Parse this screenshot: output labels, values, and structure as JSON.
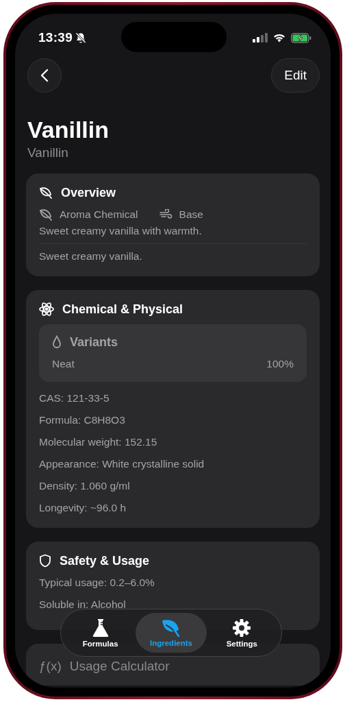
{
  "status_bar": {
    "time": "13:39",
    "silent": true,
    "charging": true
  },
  "nav": {
    "edit_label": "Edit"
  },
  "title": "Vanillin",
  "subtitle": "Vanillin",
  "overview": {
    "title": "Overview",
    "category": "Aroma Chemical",
    "note": "Base",
    "description": "Sweet creamy vanilla with warmth.",
    "summary": "Sweet creamy vanilla."
  },
  "chemical": {
    "title": "Chemical & Physical",
    "variants": {
      "title": "Variants",
      "rows": [
        {
          "name": "Neat",
          "amount": "100%"
        }
      ]
    },
    "properties": [
      "CAS: 121-33-5",
      "Formula: C8H8O3",
      "Molecular weight: 152.15",
      "Appearance: White crystalline solid",
      "Density: 1.060 g/ml",
      "Longevity: ~96.0 h"
    ]
  },
  "safety": {
    "title": "Safety & Usage",
    "lines": [
      "Typical usage: 0.2–6.0%",
      "Soluble in: Alcohol"
    ]
  },
  "calculator": {
    "icon_glyph": "ƒ(x)",
    "title": "Usage Calculator"
  },
  "tab_bar": [
    {
      "label": "Formulas",
      "kind": "flask",
      "selected": false
    },
    {
      "label": "Ingredients",
      "kind": "leaf",
      "selected": true
    },
    {
      "label": "Settings",
      "kind": "gear",
      "selected": false
    }
  ]
}
